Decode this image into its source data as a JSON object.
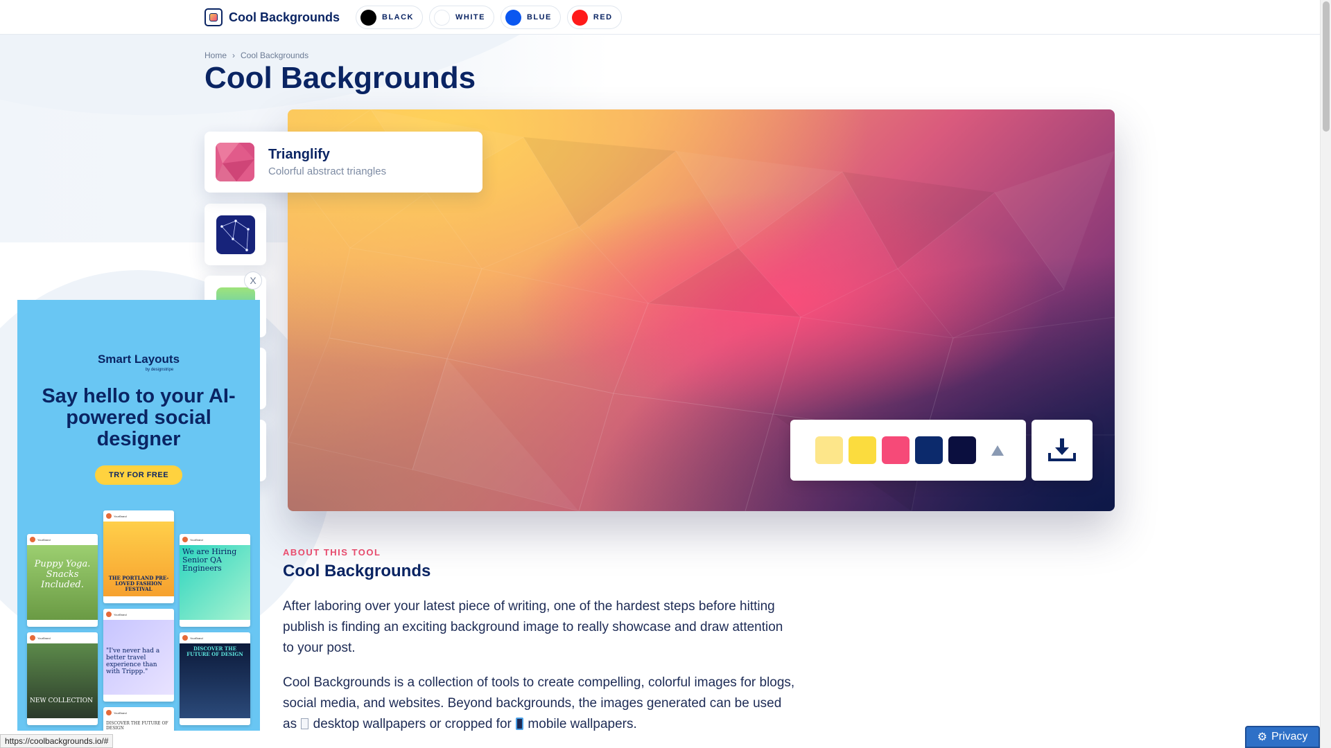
{
  "header": {
    "brand_name": "Cool Backgrounds",
    "color_filters": [
      {
        "label": "BLACK",
        "color": "#000000"
      },
      {
        "label": "WHITE",
        "color": "#ffffff"
      },
      {
        "label": "BLUE",
        "color": "#0b57f0"
      },
      {
        "label": "RED",
        "color": "#ff1a1a"
      }
    ]
  },
  "breadcrumb": {
    "home": "Home",
    "separator": "›",
    "current": "Cool Backgrounds"
  },
  "page_title": "Cool Backgrounds",
  "tool": {
    "name": "Trianglify",
    "description": "Colorful abstract triangles"
  },
  "palette": {
    "colors": [
      "#fde68a",
      "#fbdc3e",
      "#f64a78",
      "#0c2a6c",
      "#0b0f3f"
    ],
    "shape_icon": "triangle-icon",
    "download_icon": "download-icon"
  },
  "ad": {
    "brand": "Smart Layouts",
    "by": "by designstripe",
    "headline": "Say hello to your AI-powered social designer",
    "cta": "TRY FOR FREE",
    "close": "X",
    "posts": {
      "p1": "Puppy Yoga. Snacks Included.",
      "p2": "THE PORTLAND PRE-LOVED FASHION FESTIVAL",
      "p3": "We are Hiring Senior QA Engineers",
      "p4": "NEW COLLECTION",
      "p5": "\"I've never had a better travel experience than with Trippp.\"",
      "p6": "DISCOVER THE FUTURE OF DESIGN",
      "p7": "DISCOVER THE FUTURE OF DESIGN"
    }
  },
  "about": {
    "kicker": "ABOUT THIS TOOL",
    "title": "Cool Backgrounds",
    "p1": "After laboring over your latest piece of writing, one of the hardest steps before hitting publish is finding an exciting background image to really showcase and draw attention to your post.",
    "p2a": "Cool Backgrounds is a collection of tools to create compelling, colorful images for blogs, social media, and websites. Beyond backgrounds, the images generated can be used as ",
    "p2b": " desktop wallpapers or cropped for ",
    "p2c": " mobile wallpapers."
  },
  "status_url": "https://coolbackgrounds.io/#",
  "privacy_label": "Privacy"
}
